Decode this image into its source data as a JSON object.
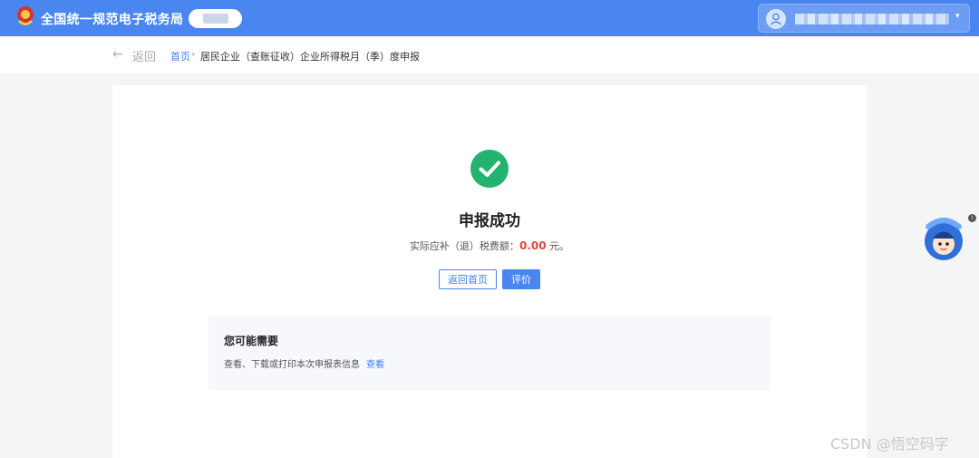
{
  "header": {
    "site_title": "全国统一规范电子税务局",
    "user_menu_caret": "▾"
  },
  "breadcrumb": {
    "back_label": "返回",
    "home_link": "首页",
    "separator": "›",
    "current_page": "居民企业（查账征收）企业所得税月（季）度申报"
  },
  "result": {
    "title": "申报成功",
    "amount_prefix": "实际应补（退）税费额：",
    "amount_value": "0.00",
    "amount_suffix": " 元。",
    "back_home_button": "返回首页",
    "rate_button": "评价"
  },
  "suggestions": {
    "title": "您可能需要",
    "description": "查看、下载或打印本次申报表信息",
    "view_link": "查看"
  },
  "assistant": {
    "badge": "!"
  },
  "watermark": "CSDN @悟空码字",
  "colors": {
    "brand_blue": "#4a86f0",
    "success_green": "#23b26f",
    "amount_red": "#e2473c"
  }
}
